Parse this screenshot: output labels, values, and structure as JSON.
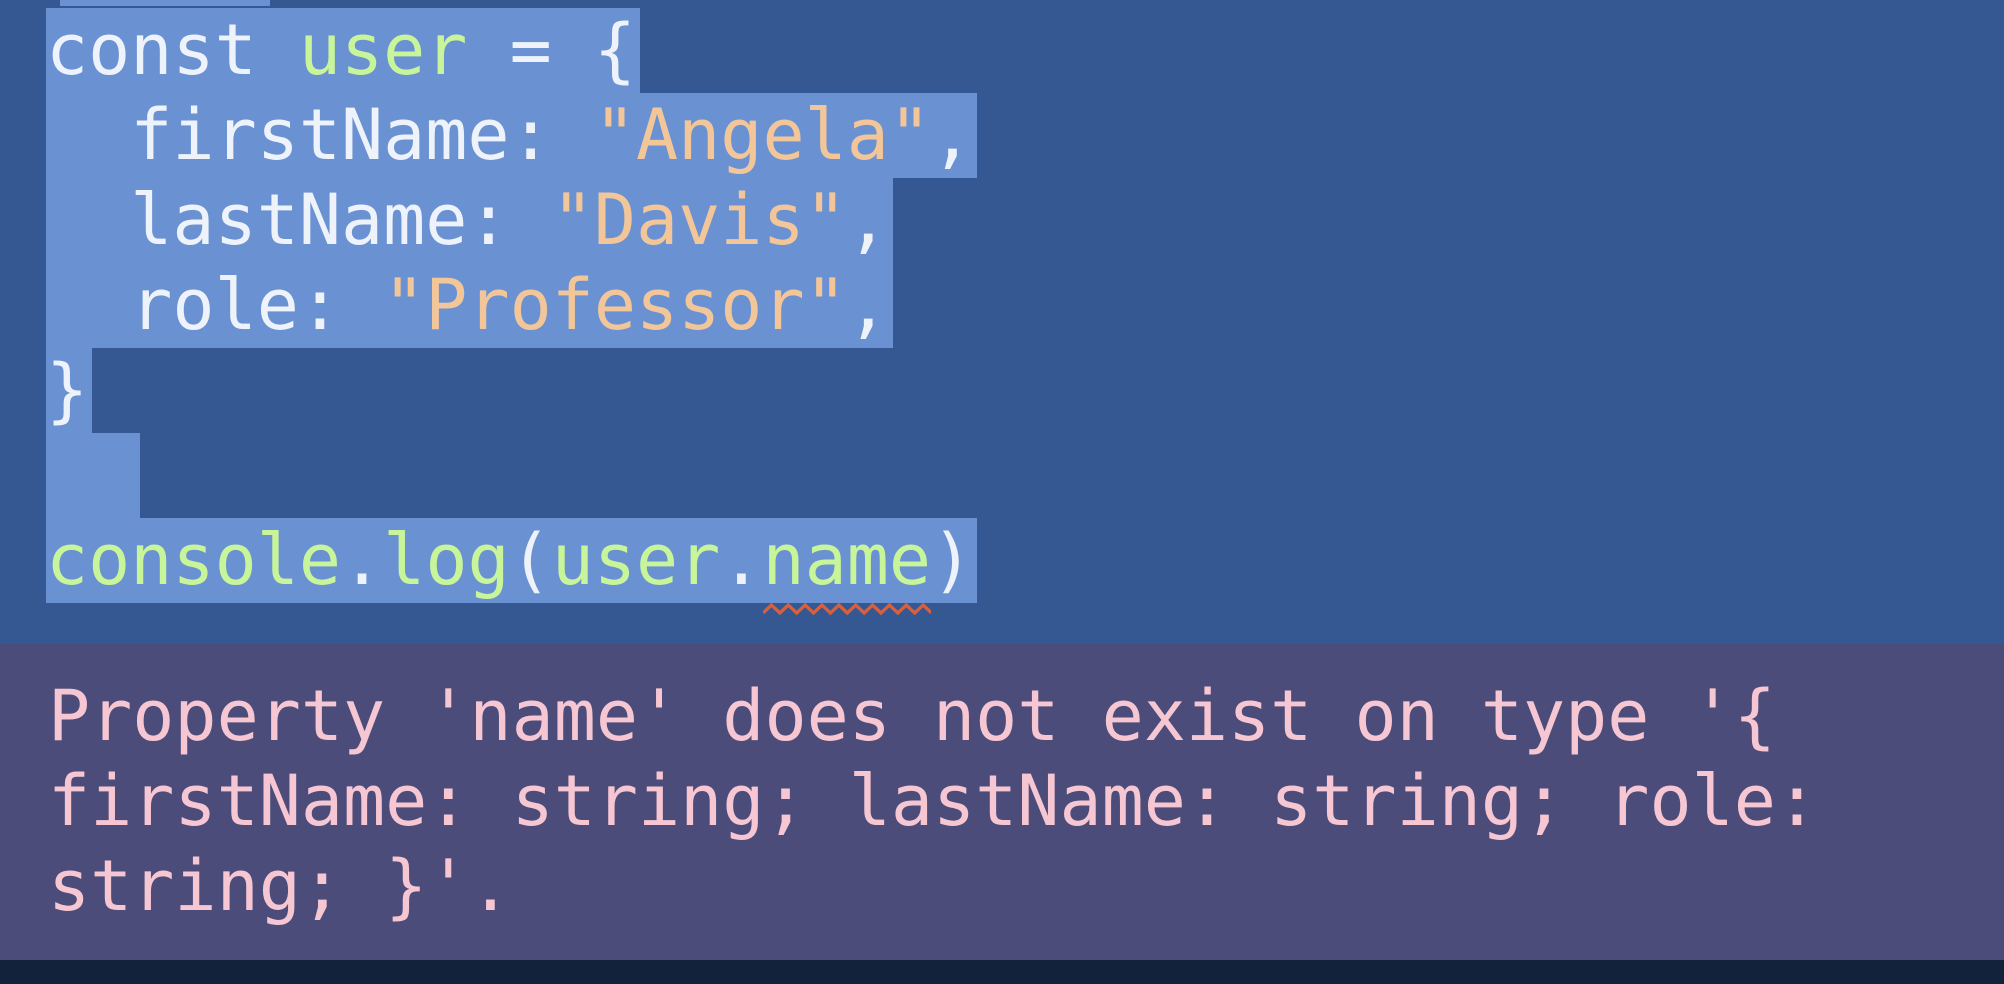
{
  "editor": {
    "lines": [
      {
        "tokens": [
          {
            "t": "const",
            "c": "kw"
          },
          {
            "t": " ",
            "c": "op"
          },
          {
            "t": "user",
            "c": "id"
          },
          {
            "t": " = {",
            "c": "op"
          }
        ]
      },
      {
        "tokens": [
          {
            "t": "  firstName: ",
            "c": "prop"
          },
          {
            "t": "\"Angela\"",
            "c": "str"
          },
          {
            "t": ",",
            "c": "punc"
          }
        ]
      },
      {
        "tokens": [
          {
            "t": "  lastName: ",
            "c": "prop"
          },
          {
            "t": "\"Davis\"",
            "c": "str"
          },
          {
            "t": ",",
            "c": "punc"
          }
        ]
      },
      {
        "tokens": [
          {
            "t": "  role: ",
            "c": "prop"
          },
          {
            "t": "\"Professor\"",
            "c": "str"
          },
          {
            "t": ",",
            "c": "punc"
          }
        ]
      },
      {
        "tokens": [
          {
            "t": "}",
            "c": "punc"
          }
        ]
      },
      {
        "tokens": []
      },
      {
        "tokens": [
          {
            "t": "console",
            "c": "id"
          },
          {
            "t": ".",
            "c": "op"
          },
          {
            "t": "log",
            "c": "id"
          },
          {
            "t": "(",
            "c": "op"
          },
          {
            "t": "user",
            "c": "id"
          },
          {
            "t": ".",
            "c": "op"
          },
          {
            "t": "name",
            "c": "id",
            "error": true
          },
          {
            "t": ")",
            "c": "op"
          }
        ]
      }
    ]
  },
  "error": {
    "message": "Property 'name' does not exist on type '{ firstName: string; lastName: string; role: string; }'."
  },
  "colors": {
    "editor_bg": "#355893",
    "selection": "#6a92d2",
    "error_bg": "#4b4c7a",
    "error_text": "#f6c7d2",
    "squiggle": "#d9603a"
  }
}
